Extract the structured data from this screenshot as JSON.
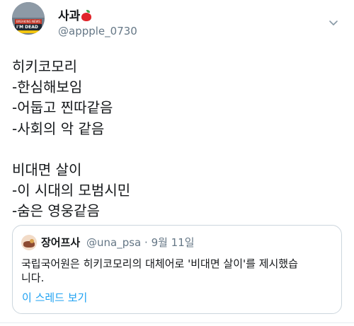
{
  "author": {
    "display_name": "사과",
    "name_emoji": "apple-icon",
    "handle": "@appple_0730",
    "avatar_banner_text": "BREAKING NEWS",
    "avatar_caption": "I'M DEAD"
  },
  "tweet": {
    "lines": [
      "히키코모리",
      "-한심해보임",
      "-어둡고 찐따같음",
      "-사회의 악 같음",
      "",
      "비대면 살이",
      "-이 시대의 모범시민",
      "-숨은 영웅같음"
    ]
  },
  "quoted": {
    "display_name": "장어프사",
    "handle": "@una_psa",
    "separator": "·",
    "date": "9월 11일",
    "text": "국립국어원은 히키코모리의 대체어로 '비대면 살이'를 제시했습니다.",
    "text_line1": "국립국어원은 히키코모리의 대체어로 '비대면 살이'를 제시했습",
    "text_line2": "니다.",
    "thread_link": "이 스레드 보기"
  },
  "colors": {
    "text": "#14171a",
    "secondary": "#657786",
    "link": "#1da1f2",
    "border": "#ccd6dd"
  }
}
